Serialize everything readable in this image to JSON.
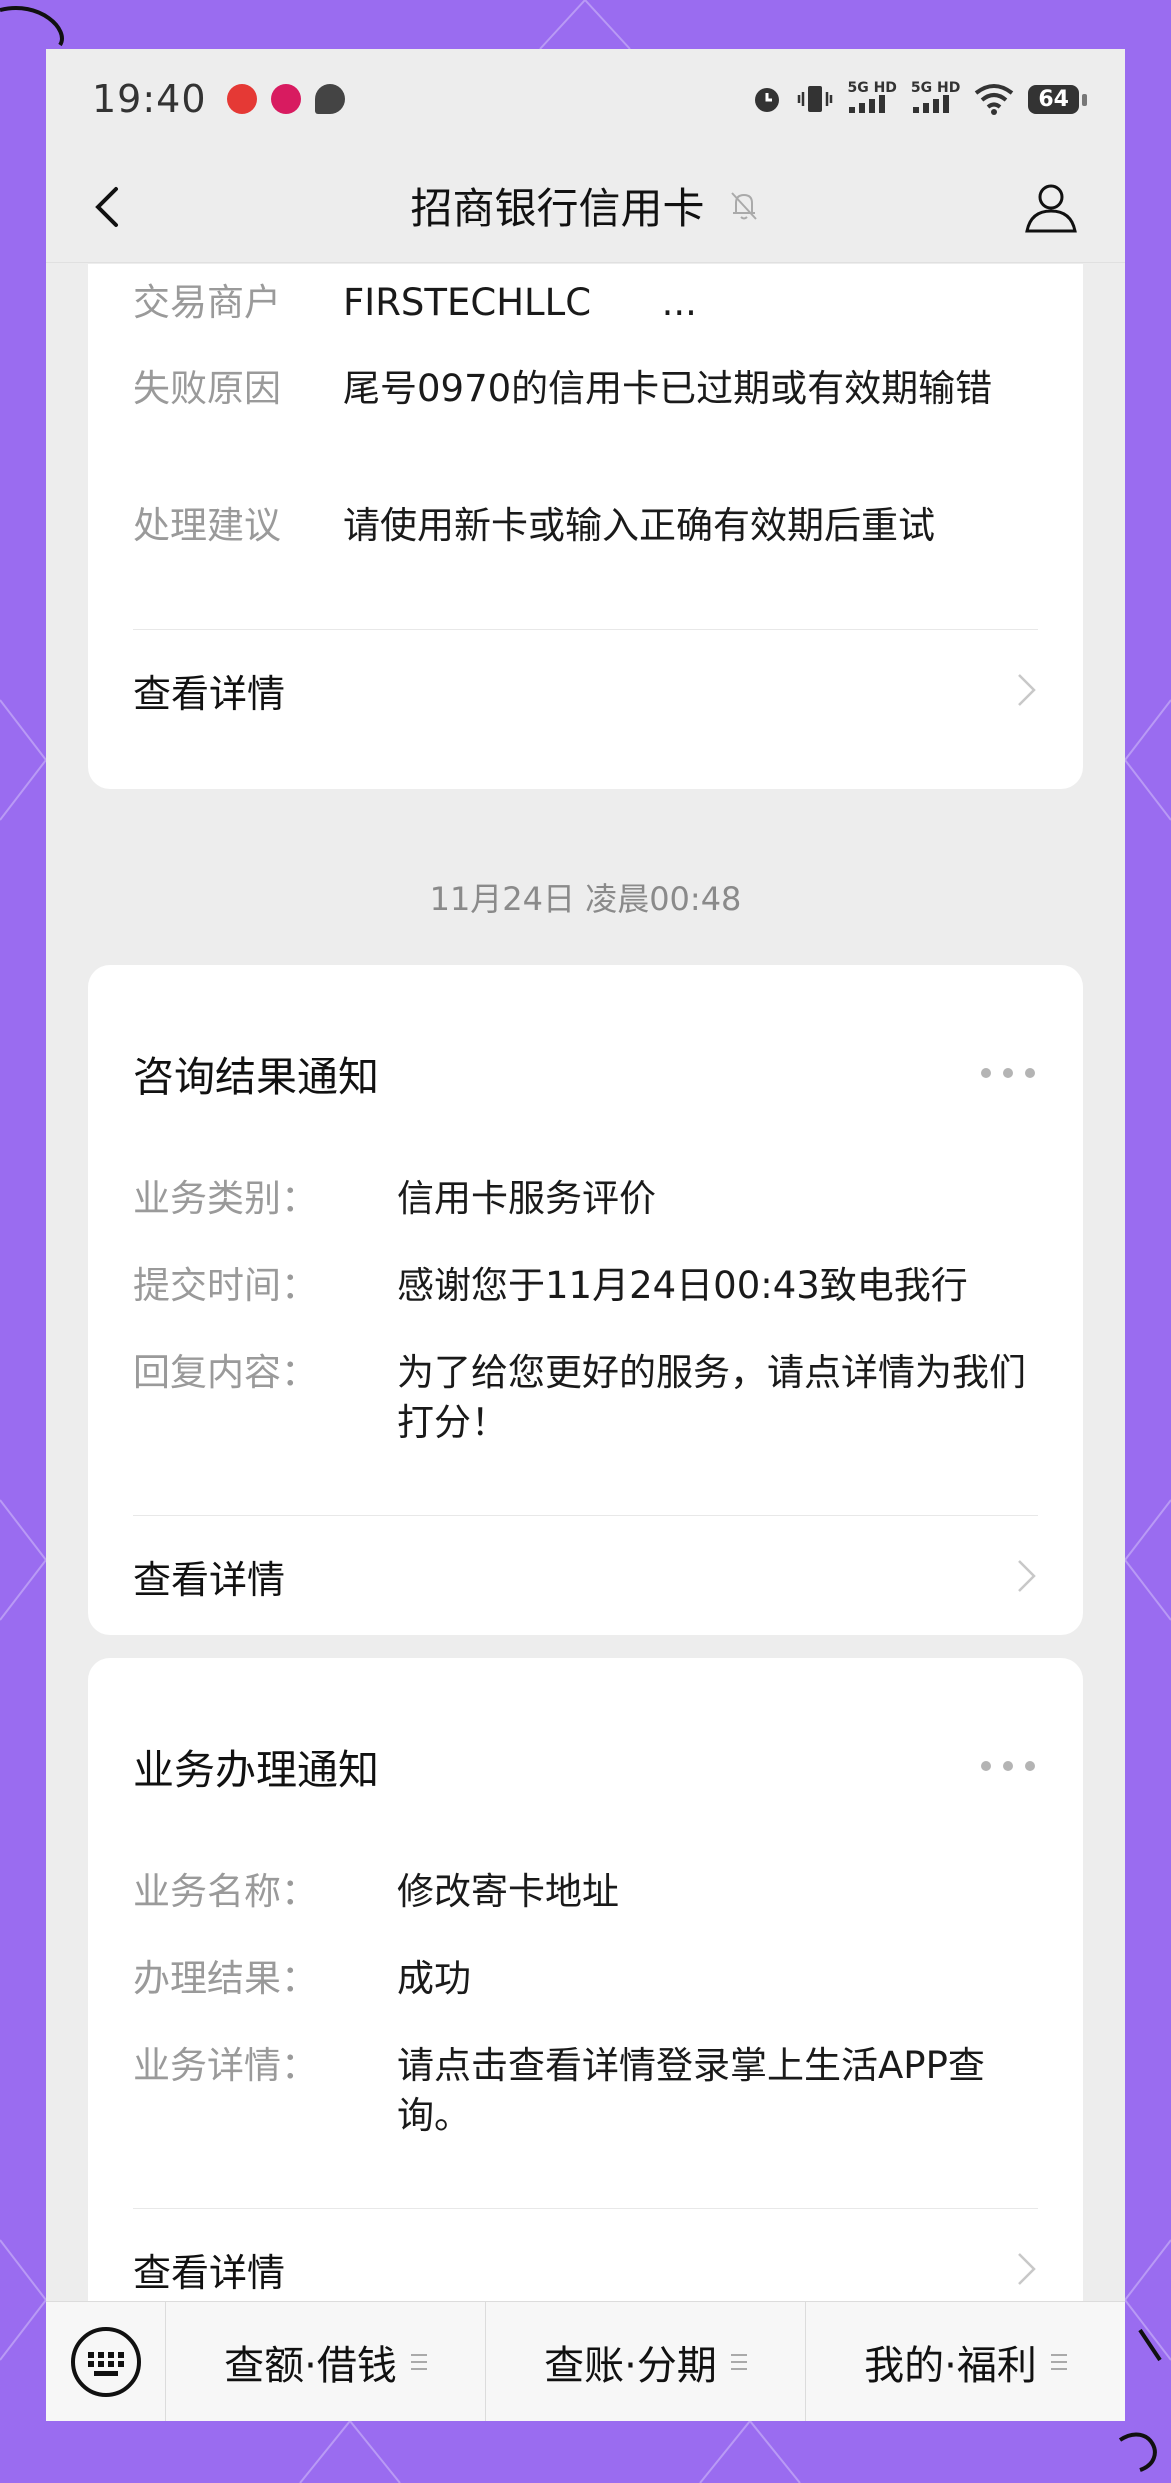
{
  "status_bar": {
    "time": "19:40",
    "signal1": "5G HD",
    "signal2": "5G HD",
    "battery": "64"
  },
  "header": {
    "title": "招商银行信用卡"
  },
  "card_top": {
    "rows": [
      {
        "label": "交易商户",
        "value": "FIRSTECHLLC      ..."
      },
      {
        "label": "失败原因",
        "value": "尾号0970的信用卡已过期或有效期输错"
      },
      {
        "label": "处理建议",
        "value": "请使用新卡或输入正确有效期后重试"
      }
    ],
    "detail_link": "查看详情"
  },
  "timestamp": "11月24日 凌晨00:48",
  "card_consult": {
    "title": "咨询结果通知",
    "rows": [
      {
        "label": "业务类别：",
        "value": "信用卡服务评价"
      },
      {
        "label": "提交时间：",
        "value": "感谢您于11月24日00:43致电我行"
      },
      {
        "label": "回复内容：",
        "value": "为了给您更好的服务，请点详情为我们打分！"
      }
    ],
    "detail_link": "查看详情"
  },
  "card_business": {
    "title": "业务办理通知",
    "rows": [
      {
        "label": "业务名称：",
        "value": "修改寄卡地址"
      },
      {
        "label": "办理结果：",
        "value": "成功"
      },
      {
        "label": "业务详情：",
        "value": "请点击查看详情登录掌上生活APP查询。"
      }
    ],
    "detail_link": "查看详情"
  },
  "bottom_menu": {
    "items": [
      "查额·借钱",
      "查账·分期",
      "我的·福利"
    ]
  }
}
